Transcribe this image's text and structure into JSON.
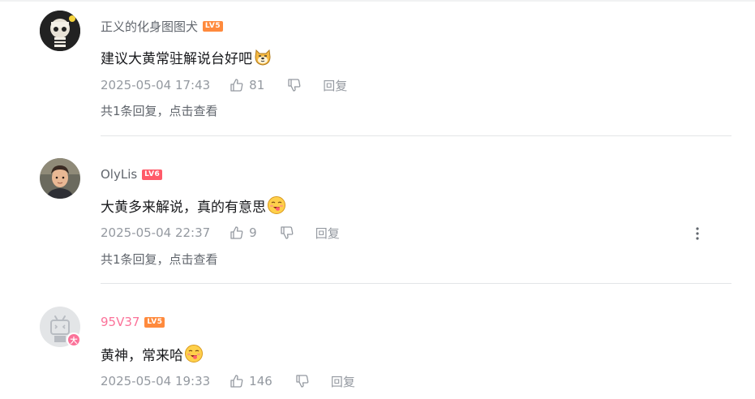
{
  "comments": [
    {
      "username": "正义的化身图图犬",
      "level": "LV5",
      "content": "建议大黄常驻解说台好吧",
      "emoji": "doge-emoji",
      "time": "2025-05-04 17:43",
      "likes": "81",
      "reply_label": "回复",
      "replies_summary": "共1条回复，点击查看"
    },
    {
      "username": "OlyLis",
      "level": "LV6",
      "content": "大黄多来解说，真的有意思",
      "emoji": "lick-lips-emoji",
      "time": "2025-05-04 22:37",
      "likes": "9",
      "reply_label": "回复",
      "replies_summary": "共1条回复，点击查看"
    },
    {
      "username": "95V37",
      "level": "LV5",
      "content": "黄神，常来哈",
      "emoji": "lick-lips-emoji",
      "time": "2025-05-04 19:33",
      "likes": "146",
      "reply_label": "回复"
    }
  ],
  "colors": {
    "vip_name": "#fb7299",
    "name": "#61666d",
    "meta": "#9499a0",
    "divider": "#e3e5e7"
  }
}
